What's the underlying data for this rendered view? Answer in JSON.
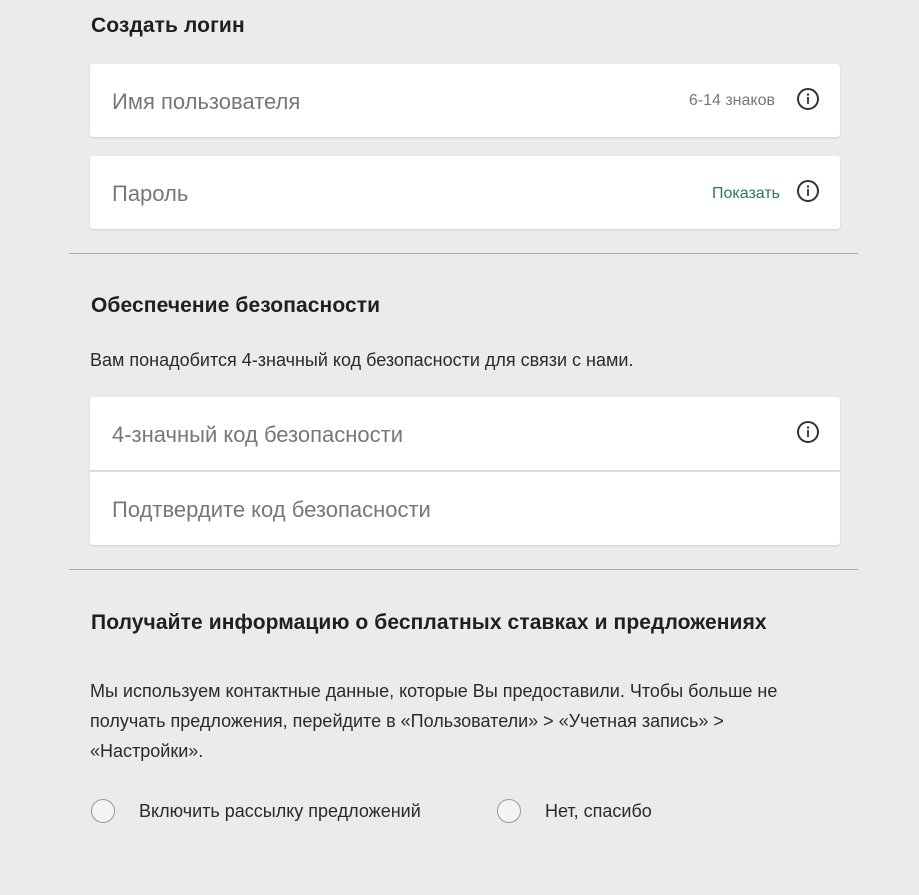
{
  "login_section": {
    "title": "Создать логин",
    "username": {
      "placeholder": "Имя пользователя",
      "hint": "6-14 знаков"
    },
    "password": {
      "placeholder": "Пароль",
      "show_label": "Показать"
    }
  },
  "security_section": {
    "title": "Обеспечение безопасности",
    "description": "Вам понадобится 4-значный код безопасности для связи с нами.",
    "code": {
      "placeholder": "4-значный код безопасности"
    },
    "confirm_code": {
      "placeholder": "Подтвердите код безопасности"
    }
  },
  "offers_section": {
    "title": "Получайте информацию о бесплатных ставках и предложениях",
    "description_lines": [
      "Мы используем контактные данные, которые Вы предоставили. Чтобы больше не",
      "получать предложения, перейдите в «Пользователи» > «Учетная запись» >",
      "«Настройки»."
    ],
    "options": [
      {
        "label": "Включить рассылку предложений",
        "selected": false
      },
      {
        "label": "Нет, спасибо",
        "selected": false
      }
    ]
  },
  "icons": {
    "info": "info-icon"
  },
  "colors": {
    "background": "#ebebe9",
    "link": "#2d7a4f"
  }
}
